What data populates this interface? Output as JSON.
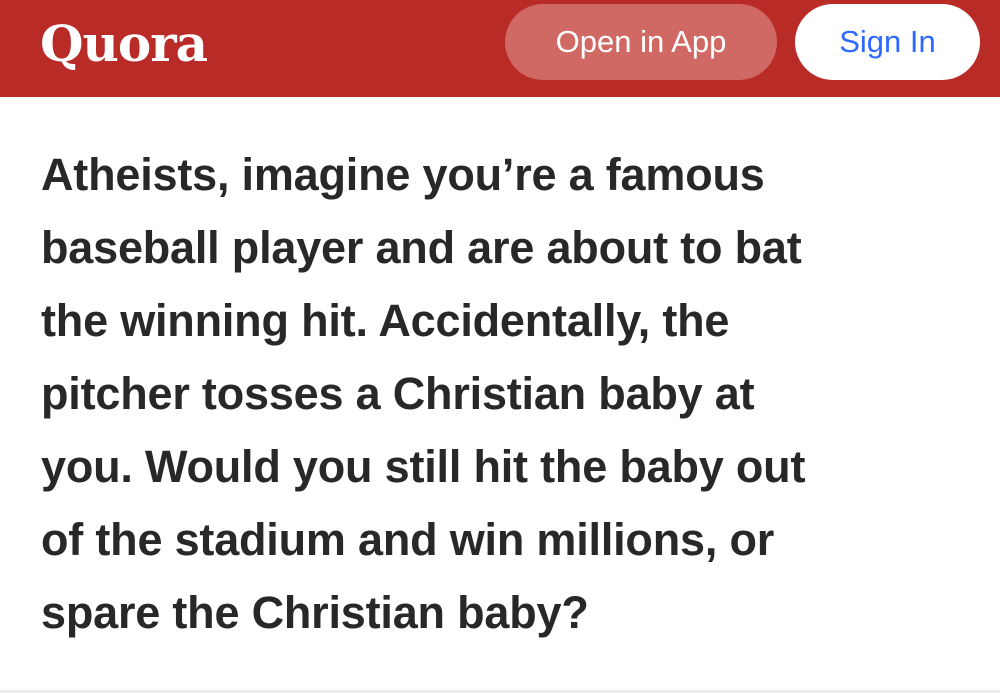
{
  "header": {
    "logo_text": "Quora",
    "open_in_app_label": "Open in App",
    "sign_in_label": "Sign In"
  },
  "question": {
    "lines": [
      "Atheists, imagine you’re a famous",
      "baseball player and are about to bat",
      "the winning hit. Accidentally, the",
      "pitcher tosses a Christian baby at",
      "you. Would you still hit the baby out",
      "of the stadium and win millions, or",
      "spare the Christian baby?"
    ]
  },
  "colors": {
    "brand_red": "#b92b27",
    "open_button_bg": "#d06864",
    "sign_in_text": "#2e69ff",
    "question_text": "#282829"
  }
}
